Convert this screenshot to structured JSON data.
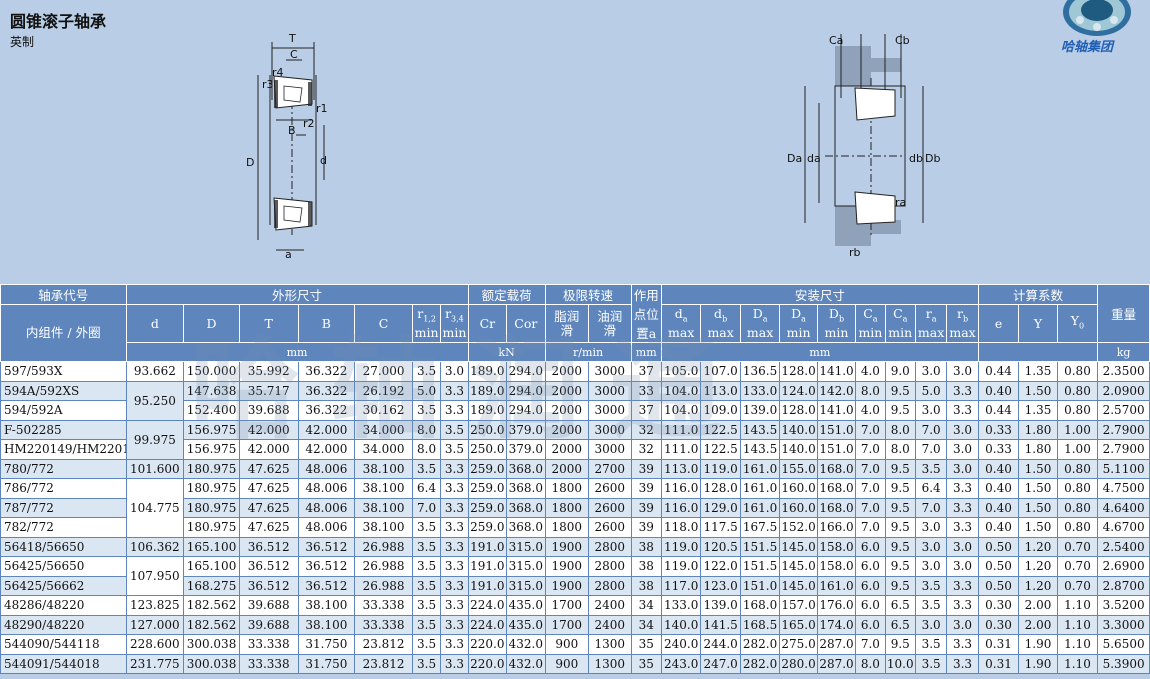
{
  "header": {
    "title": "圆锥滚子轴承",
    "subtitle": "英制",
    "brand": "哈轴集团"
  },
  "diagram_left_labels": [
    "T",
    "C",
    "r3",
    "r4",
    "r1",
    "r2",
    "B",
    "D",
    "d",
    "a"
  ],
  "diagram_right_labels": [
    "Ca",
    "Cb",
    "Da",
    "da",
    "db",
    "Db",
    "ra",
    "rb"
  ],
  "table": {
    "groups": {
      "model": "轴承代号",
      "dims": "外形尺寸",
      "load": "额定载荷",
      "speed": "极限转速",
      "point": "作用点位置a",
      "install": "安装尺寸",
      "calc": "计算系数",
      "weight": "重量",
      "parts": "内组件 / 外圈"
    },
    "col_heads": {
      "d": "d",
      "D": "D",
      "T": "T",
      "B": "B",
      "C": "C",
      "r12_top": "r",
      "r12_sub": "1,2",
      "r12_bot": "min",
      "r34_top": "r",
      "r34_sub": "3,4",
      "r34_bot": "min",
      "Cr": "Cr",
      "Cor": "Cor",
      "grease_1": "脂润",
      "grease_2": "滑",
      "oil_1": "油润",
      "oil_2": "滑",
      "point_1": "作用",
      "point_2": "点位",
      "point_3": "置a",
      "da": "d",
      "da_sub": "a",
      "da_bot": "max",
      "db": "d",
      "db_sub": "b",
      "db_bot": "max",
      "Da_max": "D",
      "Da_max_sub": "a",
      "Da_max_bot": "max",
      "Da_min": "D",
      "Da_min_sub": "a",
      "Da_min_bot": "min",
      "Db": "D",
      "Db_sub": "b",
      "Db_bot": "min",
      "Ca": "C",
      "Ca_sub": "a",
      "Ca_bot": "min",
      "Cb": "C",
      "Cb_sub": "a",
      "Cb_bot": "min",
      "ra": "r",
      "ra_sub": "a",
      "ra_bot": "max",
      "rb": "r",
      "rb_sub": "b",
      "rb_bot": "max",
      "e": "e",
      "Y": "Y",
      "Y0": "Y",
      "Y0_sub": "0"
    },
    "units": {
      "dims": "mm",
      "load": "kN",
      "speed": "r/min",
      "point": "mm",
      "install": "mm",
      "weight": "kg"
    },
    "rows": [
      [
        "597/593X",
        "93.662",
        "150.000",
        "35.992",
        "36.322",
        "27.000",
        "3.5",
        "3.0",
        "189.0",
        "294.0",
        "2000",
        "3000",
        "37",
        "105.0",
        "107.0",
        "136.5",
        "128.0",
        "141.0",
        "4.0",
        "9.0",
        "3.0",
        "3.0",
        "0.44",
        "1.35",
        "0.80",
        "2.3500"
      ],
      [
        "594A/592XS",
        "95.250",
        "147.638",
        "35.717",
        "36.322",
        "26.192",
        "5.0",
        "3.3",
        "189.0",
        "294.0",
        "2000",
        "3000",
        "33",
        "104.0",
        "113.0",
        "133.0",
        "124.0",
        "142.0",
        "8.0",
        "9.5",
        "5.0",
        "3.3",
        "0.40",
        "1.50",
        "0.80",
        "2.0900"
      ],
      [
        "594/592A",
        "",
        "152.400",
        "39.688",
        "36.322",
        "30.162",
        "3.5",
        "3.3",
        "189.0",
        "294.0",
        "2000",
        "3000",
        "37",
        "104.0",
        "109.0",
        "139.0",
        "128.0",
        "141.0",
        "4.0",
        "9.5",
        "3.0",
        "3.3",
        "0.44",
        "1.35",
        "0.80",
        "2.5700"
      ],
      [
        "F-502285",
        "99.975",
        "156.975",
        "42.000",
        "42.000",
        "34.000",
        "8.0",
        "3.5",
        "250.0",
        "379.0",
        "2000",
        "3000",
        "32",
        "111.0",
        "122.5",
        "143.5",
        "140.0",
        "151.0",
        "7.0",
        "8.0",
        "7.0",
        "3.0",
        "0.33",
        "1.80",
        "1.00",
        "2.7900"
      ],
      [
        "HM220149/HM220110",
        "",
        "156.975",
        "42.000",
        "42.000",
        "34.000",
        "8.0",
        "3.5",
        "250.0",
        "379.0",
        "2000",
        "3000",
        "32",
        "111.0",
        "122.5",
        "143.5",
        "140.0",
        "151.0",
        "7.0",
        "8.0",
        "7.0",
        "3.0",
        "0.33",
        "1.80",
        "1.00",
        "2.7900"
      ],
      [
        "780/772",
        "101.600",
        "180.975",
        "47.625",
        "48.006",
        "38.100",
        "3.5",
        "3.3",
        "259.0",
        "368.0",
        "2000",
        "2700",
        "39",
        "113.0",
        "119.0",
        "161.0",
        "155.0",
        "168.0",
        "7.0",
        "9.5",
        "3.5",
        "3.0",
        "0.40",
        "1.50",
        "0.80",
        "5.1100"
      ],
      [
        "786/772",
        "104.775",
        "180.975",
        "47.625",
        "48.006",
        "38.100",
        "6.4",
        "3.3",
        "259.0",
        "368.0",
        "1800",
        "2600",
        "39",
        "116.0",
        "128.0",
        "161.0",
        "160.0",
        "168.0",
        "7.0",
        "9.5",
        "6.4",
        "3.3",
        "0.40",
        "1.50",
        "0.80",
        "4.7500"
      ],
      [
        "787/772",
        "",
        "180.975",
        "47.625",
        "48.006",
        "38.100",
        "7.0",
        "3.3",
        "259.0",
        "368.0",
        "1800",
        "2600",
        "39",
        "116.0",
        "129.0",
        "161.0",
        "160.0",
        "168.0",
        "7.0",
        "9.5",
        "7.0",
        "3.3",
        "0.40",
        "1.50",
        "0.80",
        "4.6400"
      ],
      [
        "782/772",
        "",
        "180.975",
        "47.625",
        "48.006",
        "38.100",
        "3.5",
        "3.3",
        "259.0",
        "368.0",
        "1800",
        "2600",
        "39",
        "118.0",
        "117.5",
        "167.5",
        "152.0",
        "166.0",
        "7.0",
        "9.5",
        "3.0",
        "3.3",
        "0.40",
        "1.50",
        "0.80",
        "4.6700"
      ],
      [
        "56418/56650",
        "106.362",
        "165.100",
        "36.512",
        "36.512",
        "26.988",
        "3.5",
        "3.3",
        "191.0",
        "315.0",
        "1900",
        "2800",
        "38",
        "119.0",
        "120.5",
        "151.5",
        "145.0",
        "158.0",
        "6.0",
        "9.5",
        "3.0",
        "3.0",
        "0.50",
        "1.20",
        "0.70",
        "2.5400"
      ],
      [
        "56425/56650",
        "107.950",
        "165.100",
        "36.512",
        "36.512",
        "26.988",
        "3.5",
        "3.3",
        "191.0",
        "315.0",
        "1900",
        "2800",
        "38",
        "119.0",
        "122.0",
        "151.5",
        "145.0",
        "158.0",
        "6.0",
        "9.5",
        "3.0",
        "3.0",
        "0.50",
        "1.20",
        "0.70",
        "2.6900"
      ],
      [
        "56425/56662",
        "",
        "168.275",
        "36.512",
        "36.512",
        "26.988",
        "3.5",
        "3.3",
        "191.0",
        "315.0",
        "1900",
        "2800",
        "38",
        "117.0",
        "123.0",
        "151.0",
        "145.0",
        "161.0",
        "6.0",
        "9.5",
        "3.5",
        "3.3",
        "0.50",
        "1.20",
        "0.70",
        "2.8700"
      ],
      [
        "48286/48220",
        "123.825",
        "182.562",
        "39.688",
        "38.100",
        "33.338",
        "3.5",
        "3.3",
        "224.0",
        "435.0",
        "1700",
        "2400",
        "34",
        "133.0",
        "139.0",
        "168.0",
        "157.0",
        "176.0",
        "6.0",
        "6.5",
        "3.5",
        "3.3",
        "0.30",
        "2.00",
        "1.10",
        "3.5200"
      ],
      [
        "48290/48220",
        "127.000",
        "182.562",
        "39.688",
        "38.100",
        "33.338",
        "3.5",
        "3.3",
        "224.0",
        "435.0",
        "1700",
        "2400",
        "34",
        "140.0",
        "141.5",
        "168.5",
        "165.0",
        "174.0",
        "6.0",
        "6.5",
        "3.0",
        "3.0",
        "0.30",
        "2.00",
        "1.10",
        "3.3000"
      ],
      [
        "544090/544118",
        "228.600",
        "300.038",
        "33.338",
        "31.750",
        "23.812",
        "3.5",
        "3.3",
        "220.0",
        "432.0",
        "900",
        "1300",
        "35",
        "240.0",
        "244.0",
        "282.0",
        "275.0",
        "287.0",
        "7.0",
        "9.5",
        "3.5",
        "3.3",
        "0.31",
        "1.90",
        "1.10",
        "5.6500"
      ],
      [
        "544091/544018",
        "231.775",
        "300.038",
        "33.338",
        "31.750",
        "23.812",
        "3.5",
        "3.3",
        "220.0",
        "432.0",
        "900",
        "1300",
        "35",
        "243.0",
        "247.0",
        "282.0",
        "280.0",
        "287.0",
        "8.0",
        "10.0",
        "3.5",
        "3.3",
        "0.31",
        "1.90",
        "1.10",
        "5.3900"
      ]
    ]
  },
  "watermark": "哈轴润通"
}
